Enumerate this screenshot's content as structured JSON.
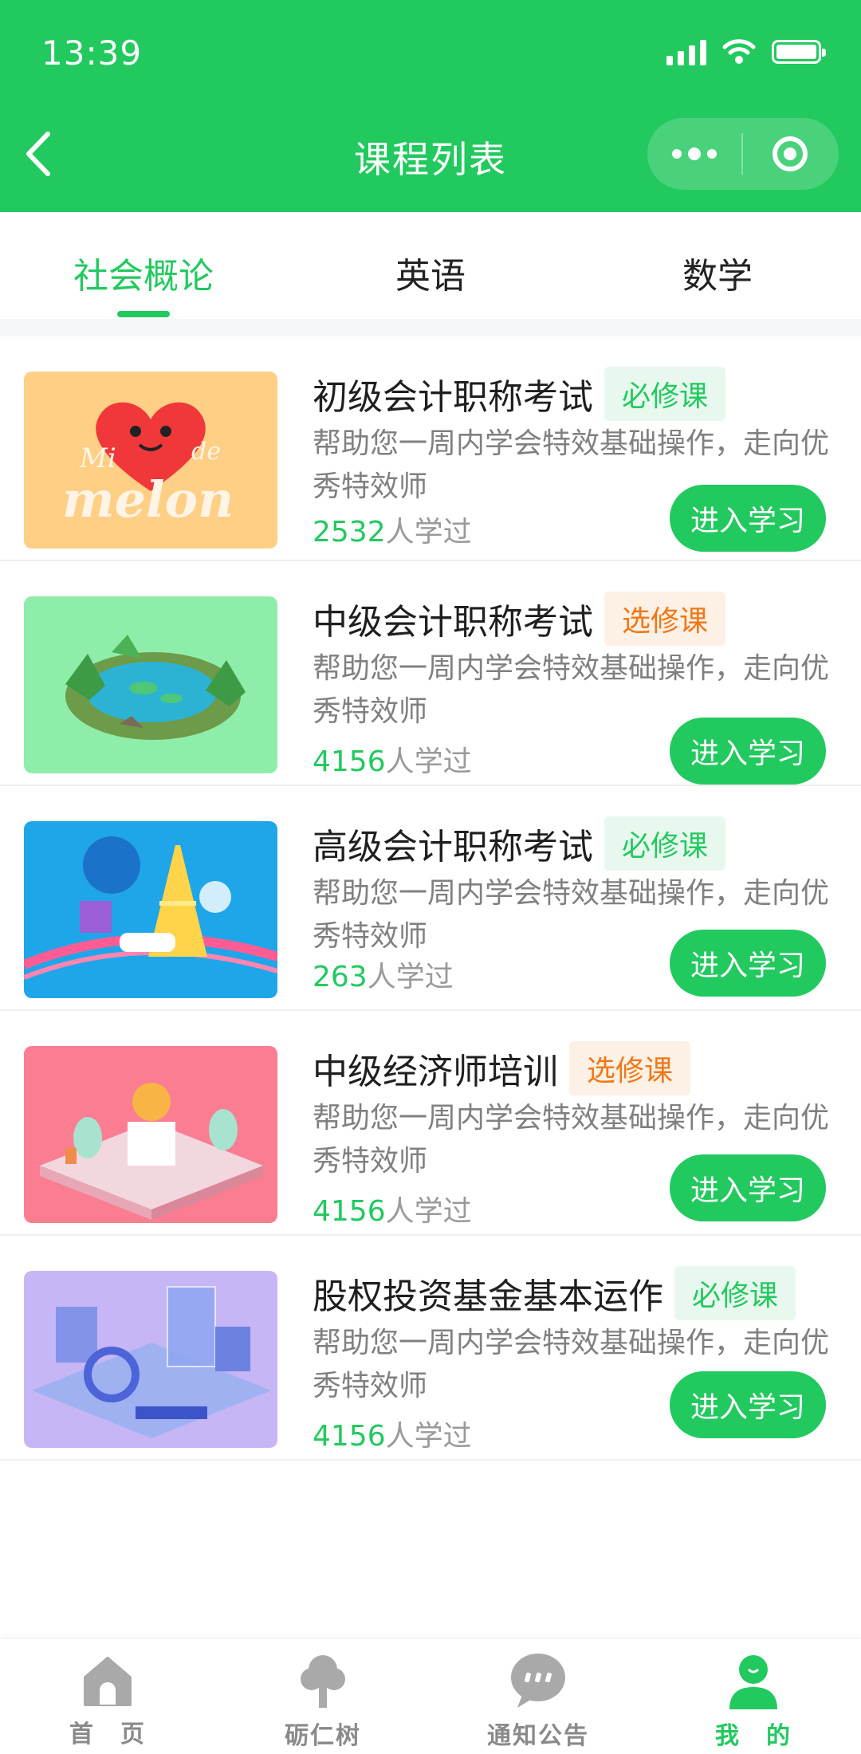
{
  "status_bar": {
    "time": "13:39"
  },
  "nav": {
    "title": "课程列表"
  },
  "tabs": [
    {
      "label": "社会概论",
      "active": true
    },
    {
      "label": "英语",
      "active": false
    },
    {
      "label": "数学",
      "active": false
    }
  ],
  "courses": [
    {
      "title": "初级会计职称考试",
      "badge": "必修课",
      "badge_type": "required",
      "desc": "帮助您一周内学会特效基础操作，走向优秀特效师",
      "count": "2532",
      "count_suffix": "人学过",
      "button": "进入学习",
      "thumb_color": "#ffcf86",
      "thumb_art": "heart-melon"
    },
    {
      "title": "中级会计职称考试",
      "badge": "选修课",
      "badge_type": "optional",
      "desc": "帮助您一周内学会特效基础操作，走向优秀特效师",
      "count": "4156",
      "count_suffix": "人学过",
      "button": "进入学习",
      "thumb_color": "#8fedaa",
      "thumb_art": "pond-island"
    },
    {
      "title": "高级会计职称考试",
      "badge": "必修课",
      "badge_type": "required",
      "desc": "帮助您一周内学会特效基础操作，走向优秀特效师",
      "count": "263",
      "count_suffix": "人学过",
      "button": "进入学习",
      "thumb_color": "#1fa6e8",
      "thumb_art": "paris-tower"
    },
    {
      "title": "中级经济师培训",
      "badge": "选修课",
      "badge_type": "optional",
      "desc": "帮助您一周内学会特效基础操作，走向优秀特效师",
      "count": "4156",
      "count_suffix": "人学过",
      "button": "进入学习",
      "thumb_color": "#fb7d91",
      "thumb_art": "park-scene"
    },
    {
      "title": "股权投资基金基本运作",
      "badge": "必修课",
      "badge_type": "required",
      "desc": "帮助您一周内学会特效基础操作，走向优秀特效师",
      "count": "4156",
      "count_suffix": "人学过",
      "button": "进入学习",
      "thumb_color": "#c6b6f6",
      "thumb_art": "city-blocks"
    }
  ],
  "bottom_tabs": [
    {
      "label": "首　页",
      "icon": "home-icon",
      "active": false
    },
    {
      "label": "砺仁树",
      "icon": "tree-icon",
      "active": false
    },
    {
      "label": "通知公告",
      "icon": "chat-bubble-icon",
      "active": false
    },
    {
      "label": "我　的",
      "icon": "user-icon",
      "active": true
    }
  ],
  "colors": {
    "primary": "#22c95f",
    "optional": "#f07818",
    "muted": "#808080"
  }
}
